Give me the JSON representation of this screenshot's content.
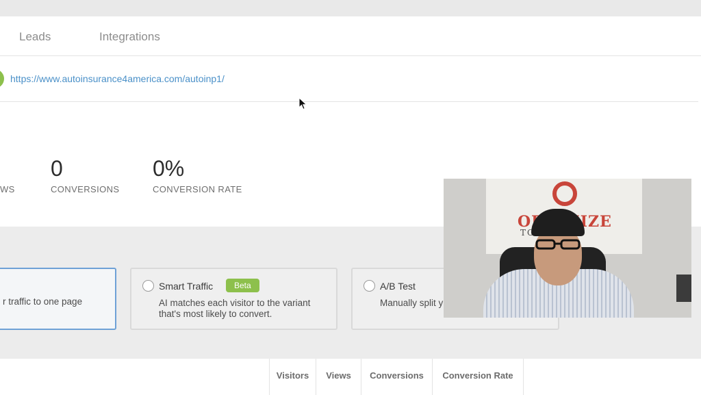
{
  "tabs": [
    {
      "label": "Leads"
    },
    {
      "label": "Integrations"
    }
  ],
  "page": {
    "url": "https://www.autoinsurance4america.com/autoinp1/"
  },
  "stats": [
    {
      "value": "",
      "label": "WS"
    },
    {
      "value": "0",
      "label": "CONVERSIONS"
    },
    {
      "value": "0%",
      "label": "CONVERSION RATE"
    }
  ],
  "traffic_modes": {
    "standard": {
      "description": "r traffic to one page"
    },
    "smart": {
      "title": "Smart Traffic",
      "badge": "Beta",
      "description": "AI matches each visitor to the variant that's most likely to convert."
    },
    "ab": {
      "title": "A/B Test",
      "description": "Manually split y or more page v"
    }
  },
  "table": {
    "columns": [
      "Visitors",
      "Views",
      "Conversions",
      "Conversion Rate"
    ]
  },
  "webcam": {
    "logo_text": "OPTIMIZE",
    "logo_sub": "TO .COM"
  },
  "colors": {
    "accent_green": "#8dc04c",
    "link_blue": "#4a90c8",
    "selected_border": "#6ea1d6"
  }
}
